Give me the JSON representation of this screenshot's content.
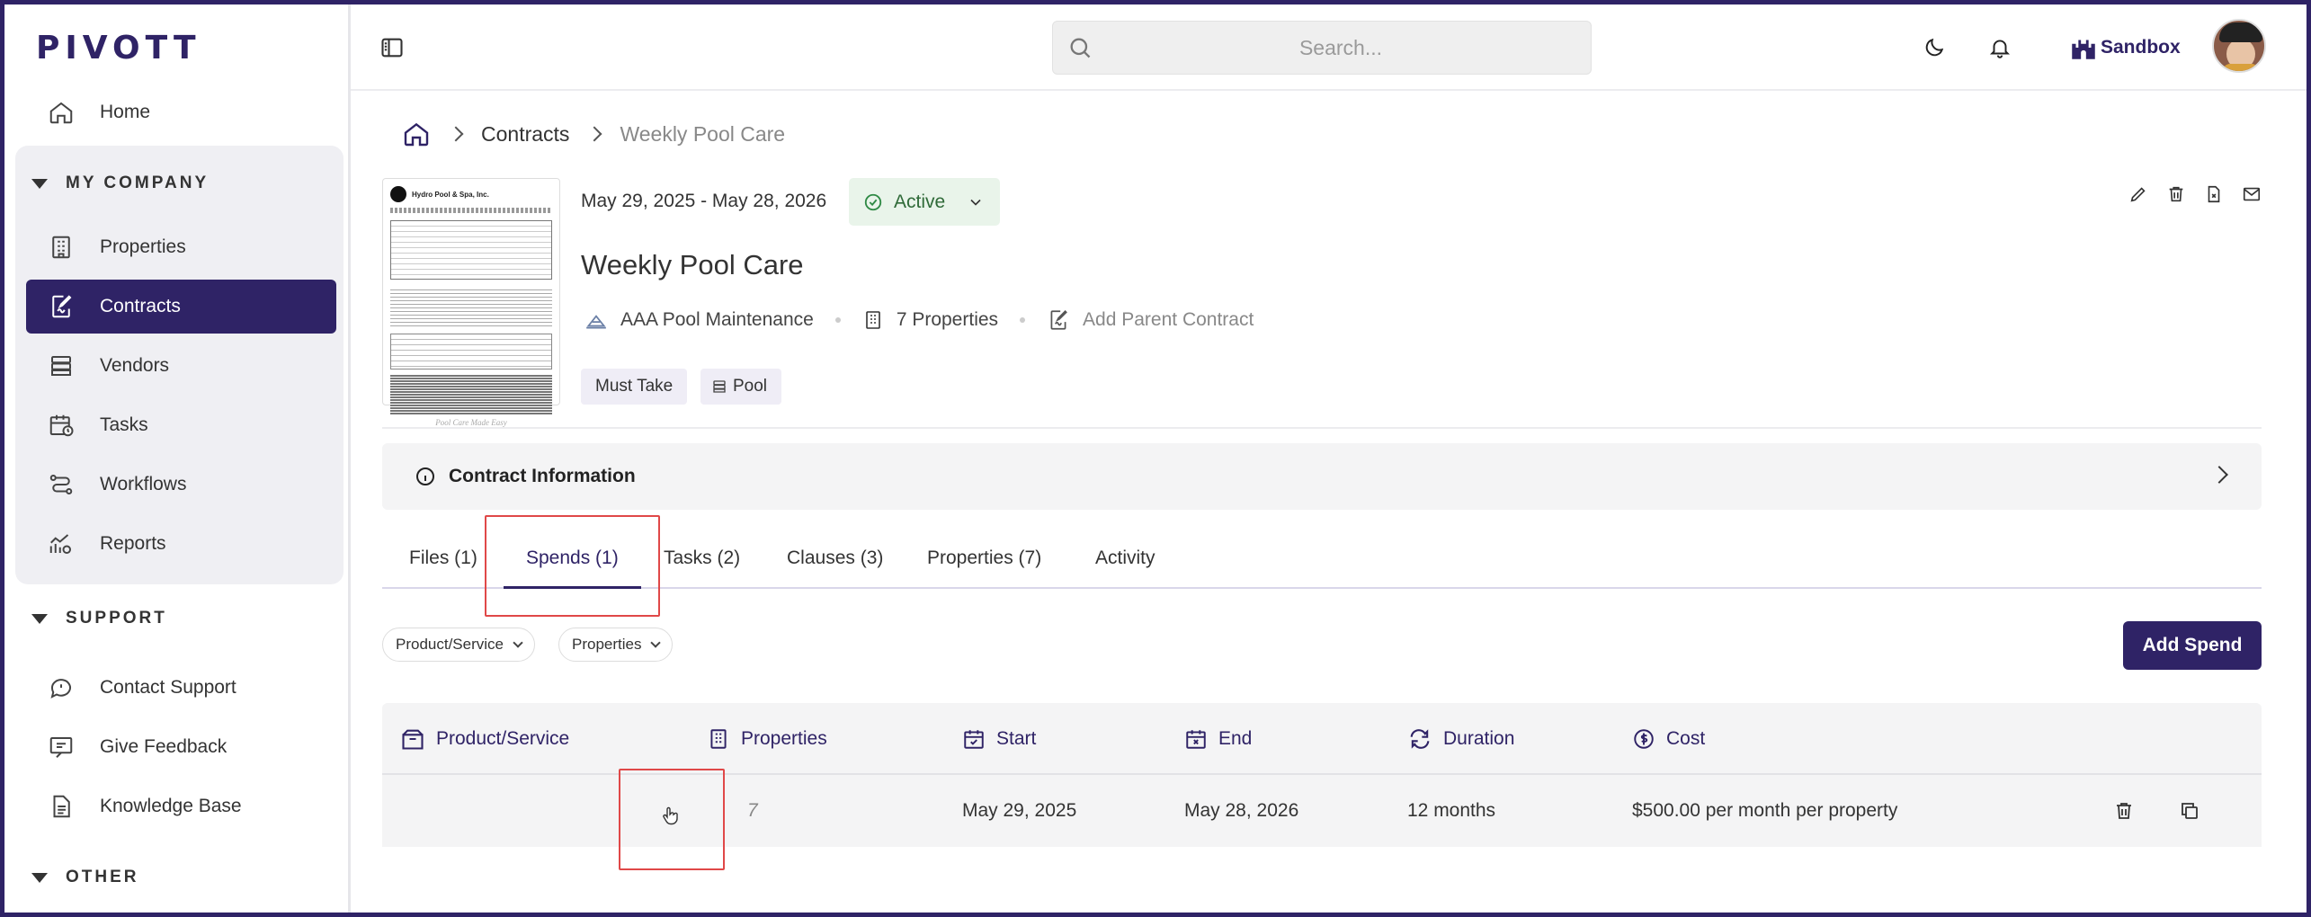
{
  "app": {
    "logo": "PIVOTT"
  },
  "sidebar": {
    "home": "Home",
    "sections": [
      {
        "label": "MY COMPANY"
      },
      {
        "label": "SUPPORT"
      },
      {
        "label": "OTHER"
      }
    ],
    "company_items": [
      {
        "label": "Properties",
        "icon": "building-icon"
      },
      {
        "label": "Contracts",
        "icon": "contract-icon",
        "active": true
      },
      {
        "label": "Vendors",
        "icon": "vendor-icon"
      },
      {
        "label": "Tasks",
        "icon": "calendar-clock-icon"
      },
      {
        "label": "Workflows",
        "icon": "workflow-icon"
      },
      {
        "label": "Reports",
        "icon": "reports-icon"
      }
    ],
    "support_items": [
      {
        "label": "Contact Support",
        "icon": "chat-icon"
      },
      {
        "label": "Give Feedback",
        "icon": "feedback-icon"
      },
      {
        "label": "Knowledge Base",
        "icon": "document-icon"
      }
    ]
  },
  "topbar": {
    "search_placeholder": "Search...",
    "sandbox_label": "Sandbox"
  },
  "breadcrumb": {
    "level1": "Contracts",
    "level2": "Weekly Pool Care"
  },
  "contract": {
    "date_range": "May 29, 2025 - May 28, 2026",
    "status": "Active",
    "title": "Weekly Pool Care",
    "vendor": "AAA Pool Maintenance",
    "properties": "7 Properties",
    "parent_link": "Add Parent Contract",
    "tags": [
      "Must Take",
      "Pool"
    ],
    "thumb_header": "Hydro Pool & Spa, Inc.",
    "thumb_footer": "Pool Care Made Easy"
  },
  "info_bar": {
    "label": "Contract Information"
  },
  "tabs": [
    "Files (1)",
    "Spends (1)",
    "Tasks (2)",
    "Clauses (3)",
    "Properties (7)",
    "Activity"
  ],
  "active_tab": "Spends (1)",
  "filters": [
    "Product/Service",
    "Properties"
  ],
  "add_spend_label": "Add Spend",
  "table": {
    "headers": [
      "Product/Service",
      "Properties",
      "Start",
      "End",
      "Duration",
      "Cost"
    ],
    "rows": [
      {
        "product": "",
        "properties": "7",
        "start": "May 29, 2025",
        "end": "May 28, 2026",
        "duration": "12 months",
        "cost": "$500.00 per month per property"
      }
    ]
  },
  "colors": {
    "brand": "#2f2366",
    "active_status_bg": "#e9f4ea",
    "active_status_text": "#2f6a38",
    "highlight": "#e04848"
  }
}
